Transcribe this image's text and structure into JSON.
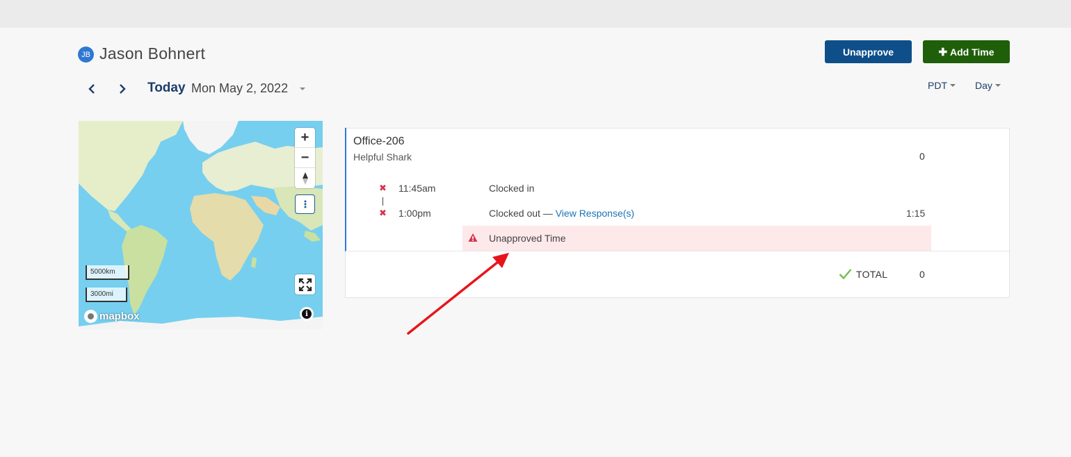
{
  "header": {
    "avatar_initials": "JB",
    "user_name": "Jason Bohnert",
    "unapprove_label": "Unapprove",
    "add_time_label": "Add Time",
    "add_time_icon": "plus-icon"
  },
  "date_nav": {
    "today_label": "Today",
    "date": "Mon May 2, 2022",
    "timezone": "PDT",
    "view": "Day"
  },
  "map": {
    "zoom_in": "+",
    "zoom_out": "−",
    "scale_km": "5000km",
    "scale_mi": "3000mi",
    "logo_text": "mapbox",
    "info": "i"
  },
  "entry": {
    "location": "Office-206",
    "job": "Helpful Shark",
    "location_total": "0",
    "events": [
      {
        "time": "11:45am",
        "label": "Clocked in",
        "status_icon": "x-icon"
      },
      {
        "time": "1:00pm",
        "label": "Clocked out — ",
        "link": "View Response(s)",
        "duration": "1:15",
        "status_icon": "x-icon"
      }
    ],
    "alert": "Unapproved Time",
    "total_label": "TOTAL",
    "total_value": "0"
  },
  "colors": {
    "unapprove_bg": "#0e4f8a",
    "add_time_bg": "#1f5f0a",
    "alert_bg": "#fde8ea",
    "accent": "#2f78d2",
    "annotation_arrow": "#e8141b"
  }
}
